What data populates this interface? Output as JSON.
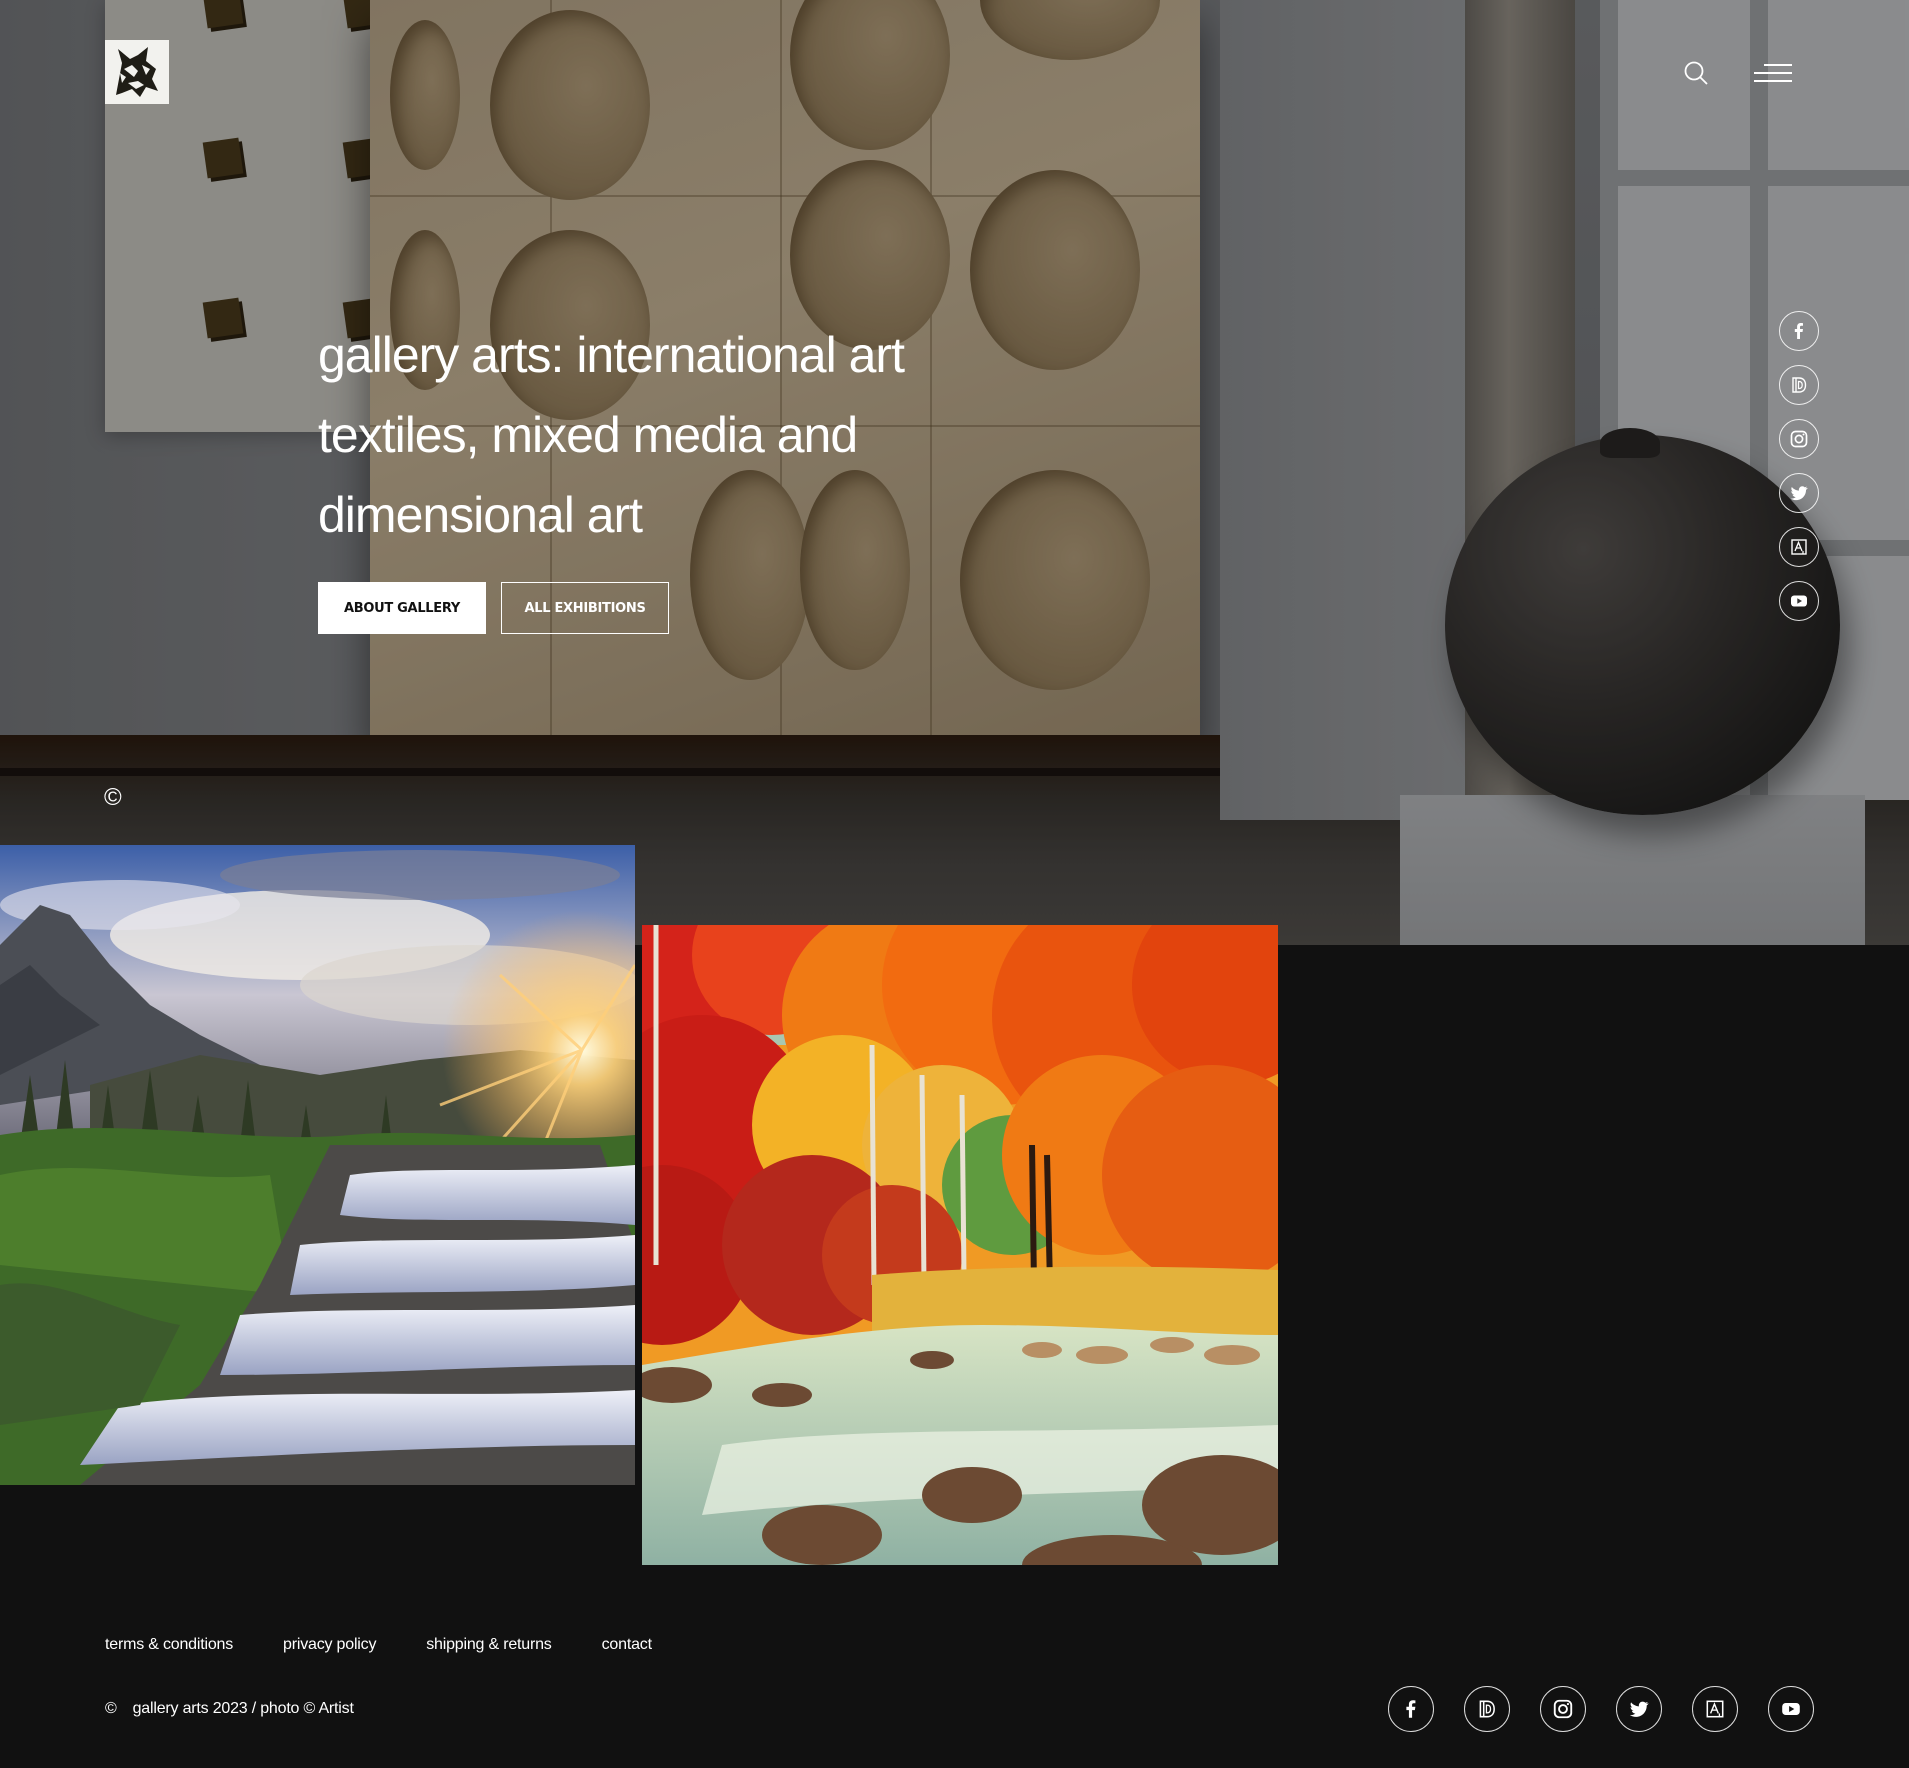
{
  "header": {
    "logo_icon": "wolf-logo-icon",
    "search_icon": "search-icon",
    "menu_icon": "hamburger-menu-icon"
  },
  "hero": {
    "title_line1": "gallery arts: international art",
    "title_line2": "textiles, mixed media and",
    "title_line3": "dimensional art",
    "buttons": {
      "about": "ABOUT GALLERY",
      "all_exhibitions": "ALL EXHIBITIONS"
    },
    "copyright_symbol": "©"
  },
  "social": [
    {
      "name": "facebook",
      "icon": "facebook-icon"
    },
    {
      "name": "behance",
      "icon": "d-logo-icon"
    },
    {
      "name": "instagram",
      "icon": "instagram-icon"
    },
    {
      "name": "twitter",
      "icon": "twitter-icon"
    },
    {
      "name": "artstation",
      "icon": "a-frame-icon"
    },
    {
      "name": "youtube",
      "icon": "youtube-icon"
    }
  ],
  "gallery": {
    "images": [
      {
        "subject": "mountain waterfall at sunset"
      },
      {
        "subject": "autumn forest river painting"
      }
    ]
  },
  "footer": {
    "links": [
      "terms & conditions",
      "privacy policy",
      "shipping & returns",
      "contact"
    ],
    "copyright_symbol": "©",
    "copyright_text": "gallery arts 2023 / photo © Artist"
  },
  "colors": {
    "page_bg": "#111111",
    "text": "#ffffff",
    "button_primary_bg": "#ffffff",
    "button_primary_text": "#111111"
  }
}
